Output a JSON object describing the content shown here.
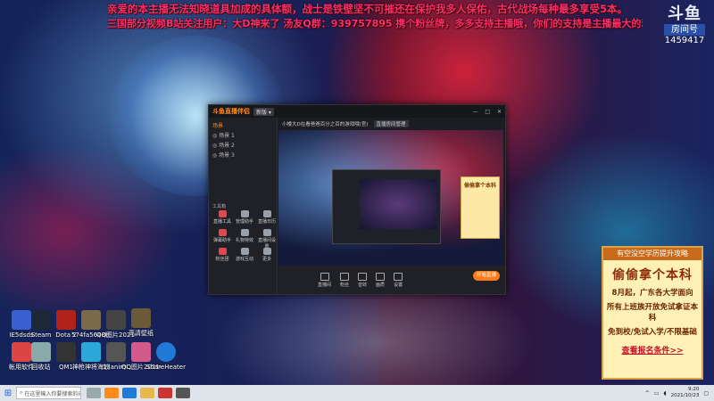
{
  "banner": {
    "line1": "亲爱的本主播无法知晓道具加成的具体额，战士是铁壁坚不可摧还在保护我多人保佑，古代战场每种最多享受5本。",
    "line2": "三国部分视频B站关注用户：大D神来了 汤友Q群：939757895 携个粉丝牌，多多支持主播哦，你们的支持是主播最大的动力"
  },
  "room": {
    "logo": "斗鱼",
    "badge": "房间号",
    "number": "1459417"
  },
  "desktop_icons": [
    {
      "label": "IE5dsds",
      "color": "#3a5fd0"
    },
    {
      "label": "Steam",
      "color": "#1b2838"
    },
    {
      "label": "Dota 2",
      "color": "#b0231b"
    },
    {
      "label": "574fa5648b...",
      "color": "#7a6a4a"
    },
    {
      "label": "QQ图片20210929...",
      "color": "#444"
    },
    {
      "label": "高清壁纸",
      "color": "#6b5a3a"
    },
    {
      "label": "帐用软件",
      "color": "#d44"
    },
    {
      "label": "回收站",
      "color": "#8aa"
    },
    {
      "label": "QM1",
      "color": "#333"
    },
    {
      "label": "神枪神将海浪",
      "color": "#2aa8d8"
    },
    {
      "label": "- 1.lanimi...",
      "color": "#555"
    },
    {
      "label": "QQ图片20210929...",
      "color": "#d35a8a"
    },
    {
      "label": "ShareHeater...",
      "color": "#1f7ad8"
    }
  ],
  "app": {
    "brand": "斗鱼直播伴侣",
    "version": "新版 ▾",
    "stream_title": "小楼大D在看爸爸百分之百的游戏哦(官)",
    "topbar_extra": "直播房间管理",
    "scenes_label": "场景",
    "scenes": [
      "◎ 场景 1",
      "◎ 场景 2",
      "◎ 场景 3"
    ],
    "tools_title": "工具箱",
    "tools": [
      "直播工具",
      "管理助手",
      "直播日历",
      "弹幕助手",
      "礼物特效",
      "直播间设置",
      "粉丝团",
      "游戏互动",
      "更多"
    ],
    "ad_text": "偷偷拿个本科",
    "bottom_buttons": [
      "直播间",
      "粉丝",
      "音效",
      "画质",
      "设置"
    ],
    "start_label": "开始直播"
  },
  "ad_panel": {
    "head": "有空没空学历提升攻略",
    "title": "偷偷拿个本科",
    "lines": [
      "8月起，广东各大学面向",
      "所有上班族开放免试拿证本科",
      "免到校/免试入学/不限基础"
    ],
    "cta": "查看报名条件>>"
  },
  "taskbar": {
    "search_placeholder": "在这里输入你要搜索的内容",
    "time": "9:20",
    "date": "2021/10/23"
  }
}
